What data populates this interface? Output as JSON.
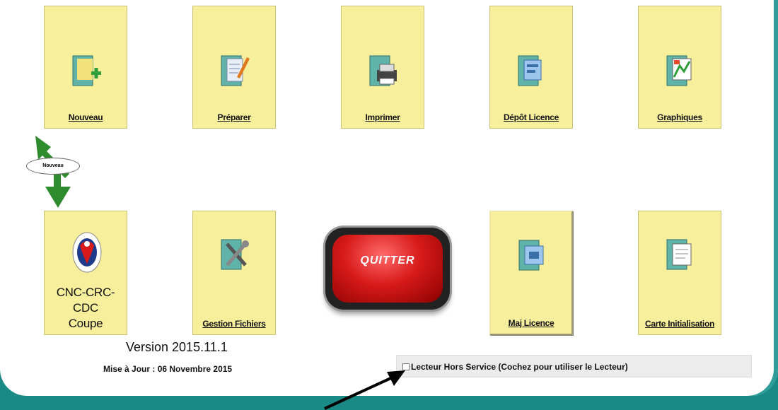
{
  "tiles_top": [
    {
      "label": "Nouveau",
      "icon": "new-folder-icon"
    },
    {
      "label": "Préparer",
      "icon": "prepare-document-icon"
    },
    {
      "label": "Imprimer",
      "icon": "printer-icon"
    },
    {
      "label": "Dépôt Licence",
      "icon": "license-deposit-icon"
    },
    {
      "label": "Graphiques",
      "icon": "charts-icon"
    }
  ],
  "tiles_bottom": [
    {
      "label_line1": "CNC-CRC-CDC",
      "label_line2": "Coupe",
      "icon": "rooster-emblem-icon"
    },
    {
      "label": "Gestion Fichiers",
      "icon": "tools-icon"
    },
    {
      "label": "Maj Licence",
      "icon": "license-update-icon"
    },
    {
      "label": "Carte Initialisation",
      "icon": "card-init-icon"
    }
  ],
  "quit_label": "QUITTER",
  "new_badge": "Nouveau",
  "version": "Version 2015.11.1",
  "update_date": "Mise à Jour : 06 Novembre 2015",
  "reader_option": "Lecteur Hors Service (Cochez pour utiliser le Lecteur)",
  "colors": {
    "background": "#1a8a86",
    "tile": "#f8ef9c",
    "quit_button": "#d81a1a",
    "arrow": "#2e8b2e"
  }
}
